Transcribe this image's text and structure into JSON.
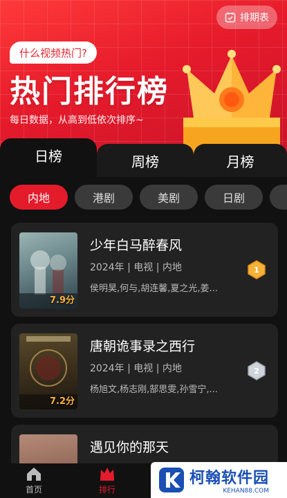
{
  "header": {
    "schedule_label": "排期表",
    "bubble": "什么视频热门?",
    "title": "热门排行榜",
    "subtitle": "每日数据，从高到低依次排序~"
  },
  "tabs": [
    {
      "label": "日榜",
      "active": true
    },
    {
      "label": "周榜",
      "active": false
    },
    {
      "label": "月榜",
      "active": false
    }
  ],
  "regions": [
    {
      "label": "内地",
      "active": true
    },
    {
      "label": "港剧",
      "active": false
    },
    {
      "label": "美剧",
      "active": false
    },
    {
      "label": "日剧",
      "active": false
    }
  ],
  "cards": [
    {
      "title": "少年白马醉春风",
      "meta": "2024年 | 电视 | 内地",
      "cast": "侯明昊,何与,胡连馨,夏之光,姜...",
      "score": "7.9分",
      "medal": "gold",
      "poster_colors": [
        "#6e8a8e",
        "#2d3f48"
      ]
    },
    {
      "title": "唐朝诡事录之西行",
      "meta": "2024年 | 电视 | 内地",
      "cast": "杨旭文,杨志刚,郜思雯,孙雪宁,...",
      "score": "7.2分",
      "medal": "silver",
      "poster_colors": [
        "#5a4a2a",
        "#1d1812"
      ]
    },
    {
      "title": "遇见你的那天",
      "meta": "",
      "cast": "",
      "score": "",
      "medal": "",
      "poster_colors": [
        "#b58a78",
        "#6a4a40"
      ]
    }
  ],
  "bottom_nav": [
    {
      "label": "首页",
      "active": false,
      "icon": "home-icon"
    },
    {
      "label": "排行",
      "active": true,
      "icon": "crown-icon"
    }
  ],
  "watermark": {
    "title": "柯翰软件园",
    "url": "KEHAN88.COM"
  },
  "colors": {
    "accent": "#e41b2b",
    "background": "#111111",
    "card": "#222222"
  }
}
